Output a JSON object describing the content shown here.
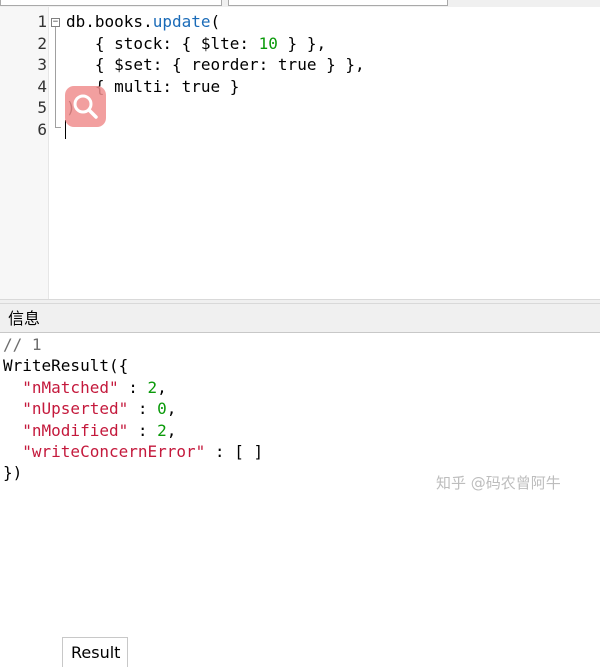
{
  "editor": {
    "line_numbers": [
      "1",
      "2",
      "3",
      "4",
      "5",
      "6"
    ],
    "lines": [
      [
        {
          "t": "db.books.",
          "c": ""
        },
        {
          "t": "update",
          "c": "kw"
        },
        {
          "t": "(",
          "c": ""
        }
      ],
      [
        {
          "t": "   { stock: { $lte: ",
          "c": ""
        },
        {
          "t": "10",
          "c": "num"
        },
        {
          "t": " } },",
          "c": ""
        }
      ],
      [
        {
          "t": "   { $set: { reorder: true } },",
          "c": ""
        }
      ],
      [
        {
          "t": "   { multi: true }",
          "c": ""
        }
      ],
      [
        {
          "t": ")",
          "c": ""
        }
      ],
      [
        {
          "t": "",
          "c": ""
        }
      ]
    ]
  },
  "tabs": {
    "info_label": "信息",
    "result_label": "Result"
  },
  "result": {
    "lines": [
      [
        {
          "t": "// 1",
          "c": "comment"
        }
      ],
      [
        {
          "t": "WriteResult({",
          "c": ""
        }
      ],
      [
        {
          "t": "  ",
          "c": ""
        },
        {
          "t": "\"nMatched\"",
          "c": "key"
        },
        {
          "t": " : ",
          "c": ""
        },
        {
          "t": "2",
          "c": "rnum"
        },
        {
          "t": ",",
          "c": ""
        }
      ],
      [
        {
          "t": "  ",
          "c": ""
        },
        {
          "t": "\"nUpserted\"",
          "c": "key"
        },
        {
          "t": " : ",
          "c": ""
        },
        {
          "t": "0",
          "c": "rnum"
        },
        {
          "t": ",",
          "c": ""
        }
      ],
      [
        {
          "t": "  ",
          "c": ""
        },
        {
          "t": "\"nModified\"",
          "c": "key"
        },
        {
          "t": " : ",
          "c": ""
        },
        {
          "t": "2",
          "c": "rnum"
        },
        {
          "t": ",",
          "c": ""
        }
      ],
      [
        {
          "t": "  ",
          "c": ""
        },
        {
          "t": "\"writeConcernError\"",
          "c": "key"
        },
        {
          "t": " : [ ]",
          "c": ""
        }
      ],
      [
        {
          "t": "})",
          "c": ""
        }
      ]
    ]
  },
  "watermark": "知乎 @码农曾阿牛",
  "colors": {
    "keyword": "#1a6bb8",
    "number": "#0a9a0a",
    "result_key": "#c4193c",
    "comment": "#6e6e6e",
    "search_badge": "#f08f8f"
  }
}
